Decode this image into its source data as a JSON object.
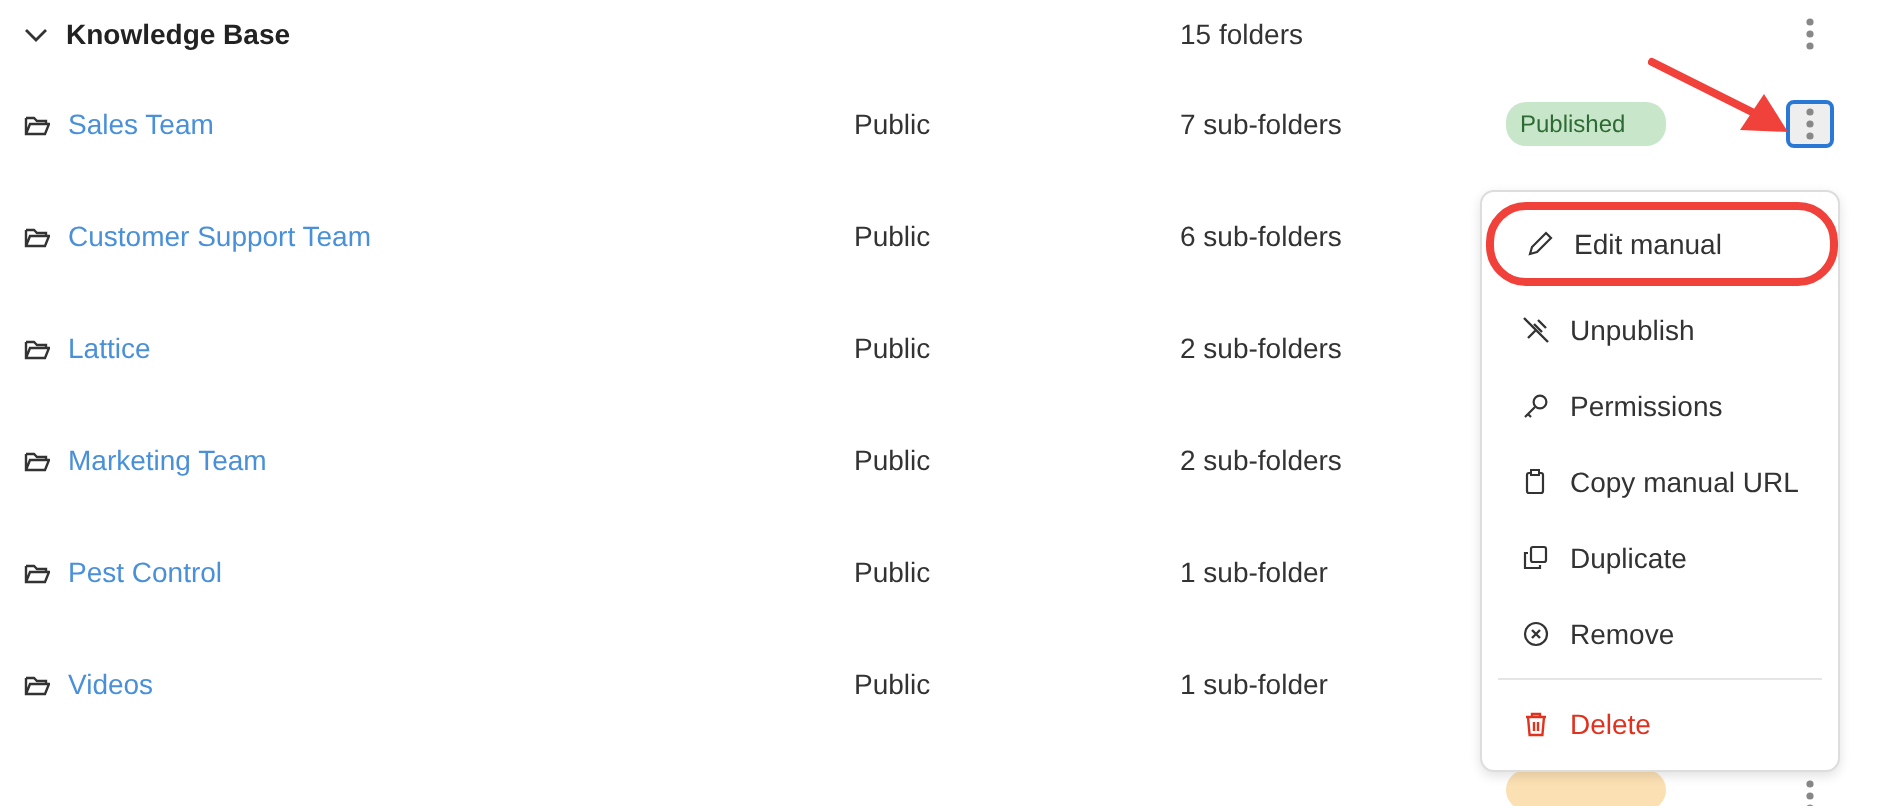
{
  "group": {
    "title": "Knowledge Base",
    "expanded": true,
    "count": "15 folders",
    "menu_button": {
      "focused": false
    }
  },
  "rows": [
    {
      "name": "Sales Team",
      "visibility": "Public",
      "count": "7 sub-folders",
      "badge": {
        "text": "Published",
        "color": "#c8e6c9"
      },
      "menu_button": {
        "focused": true
      }
    },
    {
      "name": "Customer Support Team",
      "visibility": "Public",
      "count": "6 sub-folders"
    },
    {
      "name": "Lattice",
      "visibility": "Public",
      "count": "2 sub-folders"
    },
    {
      "name": "Marketing Team",
      "visibility": "Public",
      "count": "2 sub-folders"
    },
    {
      "name": "Pest Control",
      "visibility": "Public",
      "count": "1 sub-folder"
    },
    {
      "name": "Videos",
      "visibility": "Public",
      "count": "1 sub-folder"
    },
    {
      "badge": {
        "color": "#fbe0b3"
      },
      "menu_button": {
        "focused": false
      }
    }
  ],
  "menu": {
    "items": [
      {
        "kind": "edit",
        "label": "Edit manual",
        "highlighted": true
      },
      {
        "kind": "unpublish",
        "label": "Unpublish",
        "highlighted": false
      },
      {
        "kind": "permissions",
        "label": "Permissions",
        "highlighted": false
      },
      {
        "kind": "copy",
        "label": "Copy manual URL",
        "highlighted": false
      },
      {
        "kind": "duplicate",
        "label": "Duplicate",
        "highlighted": false
      },
      {
        "kind": "remove",
        "label": "Remove",
        "highlighted": false
      },
      {
        "kind": "divider"
      },
      {
        "kind": "delete",
        "label": "Delete",
        "highlighted": false
      }
    ]
  },
  "annotation_arrow": true
}
